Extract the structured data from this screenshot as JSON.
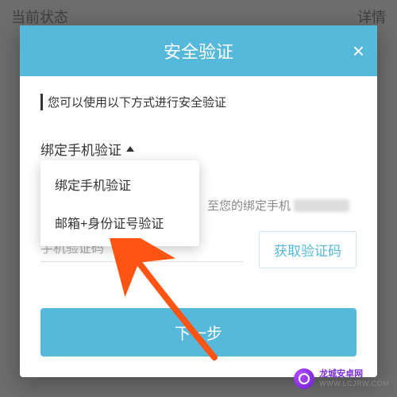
{
  "background": {
    "left_label": "当前状态",
    "right_label": "详情"
  },
  "modal": {
    "title": "安全验证",
    "close_glyph": "×",
    "instruction": "您可以使用以下方式进行安全验证",
    "dropdown": {
      "selected": "绑定手机验证",
      "options": [
        "绑定手机验证",
        "邮箱+身份证号验证"
      ]
    },
    "hint_suffix": "至您的绑定手机",
    "code_placeholder": "手机验证码",
    "get_code_label": "获取验证码",
    "next_label": "下一步"
  },
  "colors": {
    "accent": "#56b9dc",
    "arrow": "#ff5412"
  },
  "watermark": {
    "name": "龙城安卓网",
    "url": "WWW.LCJRW.COM"
  }
}
